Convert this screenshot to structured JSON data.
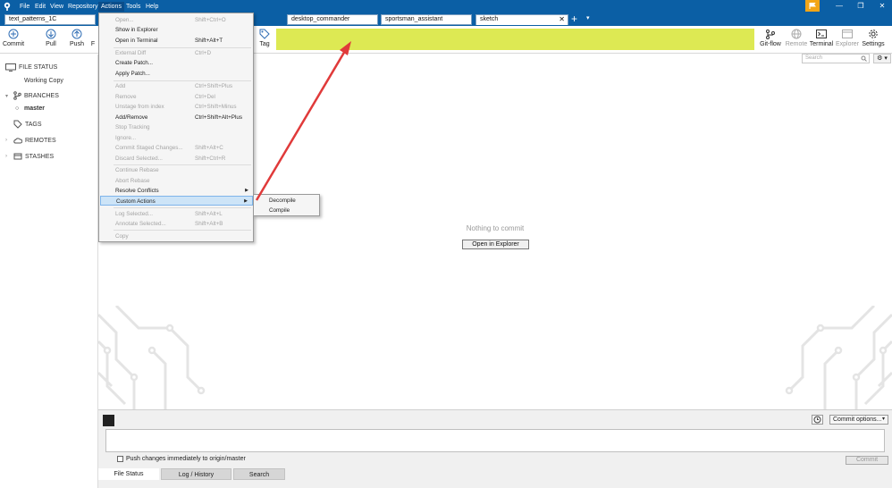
{
  "menubar": {
    "items": [
      "File",
      "Edit",
      "View",
      "Repository",
      "Actions",
      "Tools",
      "Help"
    ],
    "active": "Actions"
  },
  "window_controls": {
    "minimize": "—",
    "maximize": "❐",
    "close": "✕"
  },
  "tabs": [
    {
      "label": "text_patterns_1C"
    },
    {
      "label": "desktop_commander"
    },
    {
      "label": "sportsman_assistant"
    },
    {
      "label": "sketch",
      "close": "✕"
    }
  ],
  "tab_add_label": "+",
  "tab_menu_label": "▾",
  "toolbar": {
    "left": [
      {
        "label": "Commit",
        "icon": "plus-circle-icon"
      },
      {
        "label": "Pull",
        "icon": "arrow-down-icon"
      },
      {
        "label": "Push",
        "icon": "arrow-up-icon"
      },
      {
        "label": "F"
      },
      {
        "label": "Tag",
        "icon": "tag-icon"
      }
    ],
    "right": [
      {
        "label": "Git-flow",
        "icon": "git-flow-icon",
        "disabled": false
      },
      {
        "label": "Remote",
        "icon": "globe-icon",
        "disabled": true
      },
      {
        "label": "Terminal",
        "icon": "terminal-icon",
        "disabled": false
      },
      {
        "label": "Explorer",
        "icon": "folder-icon",
        "disabled": true
      },
      {
        "label": "Settings",
        "icon": "gear-icon",
        "disabled": false
      }
    ],
    "highlight_color": "#dde953"
  },
  "sidebar": {
    "file_status": "FILE STATUS",
    "working_copy": "Working Copy",
    "branches": "BRANCHES",
    "master": "master",
    "tags": "TAGS",
    "remotes": "REMOTES",
    "stashes": "STASHES"
  },
  "search": {
    "placeholder": "Search"
  },
  "main": {
    "empty_message": "Nothing to commit",
    "open_button": "Open in Explorer"
  },
  "actions_menu": {
    "items": [
      {
        "label": "Open...",
        "shortcut": "Shift+Ctrl+O",
        "disabled": true
      },
      {
        "label": "Show in Explorer",
        "shortcut": "",
        "disabled": false
      },
      {
        "label": "Open in Terminal",
        "shortcut": "Shift+Alt+T",
        "disabled": false
      },
      {
        "label": "External Diff",
        "shortcut": "Ctrl+D",
        "disabled": true
      },
      {
        "label": "Create Patch...",
        "shortcut": "",
        "disabled": false
      },
      {
        "label": "Apply Patch...",
        "shortcut": "",
        "disabled": false
      },
      {
        "label": "Add",
        "shortcut": "Ctrl+Shift+Plus",
        "disabled": true
      },
      {
        "label": "Remove",
        "shortcut": "Ctrl+Del",
        "disabled": true
      },
      {
        "label": "Unstage from index",
        "shortcut": "Ctrl+Shift+Minus",
        "disabled": true
      },
      {
        "label": "Add/Remove",
        "shortcut": "Ctrl+Shift+Alt+Plus",
        "disabled": false
      },
      {
        "label": "Stop Tracking",
        "shortcut": "",
        "disabled": true
      },
      {
        "label": "Ignore...",
        "shortcut": "",
        "disabled": true
      },
      {
        "label": "Commit Staged Changes...",
        "shortcut": "Shift+Alt+C",
        "disabled": true
      },
      {
        "label": "Discard Selected...",
        "shortcut": "Shift+Ctrl+R",
        "disabled": true
      },
      {
        "label": "Continue Rebase",
        "shortcut": "",
        "disabled": true
      },
      {
        "label": "Abort Rebase",
        "shortcut": "",
        "disabled": true
      },
      {
        "label": "Resolve Conflicts",
        "shortcut": "",
        "disabled": false,
        "submenu": true
      },
      {
        "label": "Custom Actions",
        "shortcut": "",
        "disabled": false,
        "submenu": true,
        "highlighted": true
      },
      {
        "label": "Log Selected...",
        "shortcut": "Shift+Alt+L",
        "disabled": true
      },
      {
        "label": "Annotate Selected...",
        "shortcut": "Shift+Alt+B",
        "disabled": true
      },
      {
        "label": "Copy",
        "shortcut": "",
        "disabled": true
      }
    ],
    "submenu_arrow": "▶"
  },
  "custom_actions_submenu": [
    "Decompile",
    "Compile"
  ],
  "commit_area": {
    "options_label": "Commit options...",
    "options_arrow": "▾",
    "push_label": "Push changes immediately to origin/master",
    "commit_button": "Commit"
  },
  "bottom_tabs": [
    "File Status",
    "Log / History",
    "Search"
  ],
  "colors": {
    "titlebar": "#0b5fa5",
    "arrow": "#e03a3a",
    "flag": "#f2a517"
  }
}
